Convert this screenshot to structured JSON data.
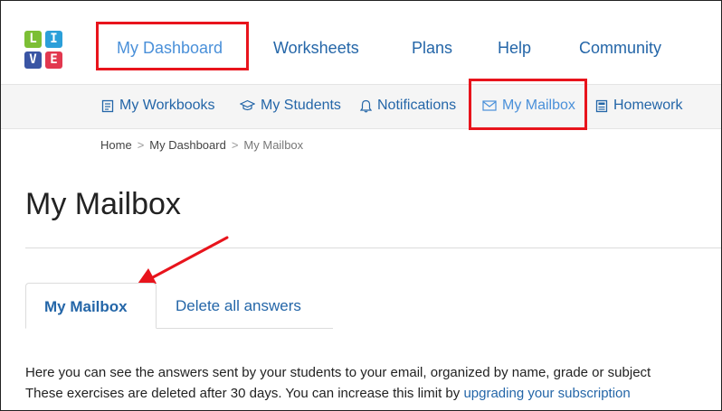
{
  "logo": {
    "letters": [
      "L",
      "I",
      "V",
      "E"
    ],
    "colors": [
      "#7cbf35",
      "#2b9fd9",
      "#3a55a4",
      "#e2384f"
    ]
  },
  "main_menu": {
    "dashboard": "My Dashboard",
    "worksheets": "Worksheets",
    "plans": "Plans",
    "help": "Help",
    "community": "Community"
  },
  "sub_menu": {
    "workbooks": {
      "label": "My Workbooks",
      "icon": "workbook-icon"
    },
    "students": {
      "label": "My Students",
      "icon": "graduation-cap-icon"
    },
    "notifications": {
      "label": "Notifications",
      "icon": "bell-icon"
    },
    "mailbox": {
      "label": "My Mailbox",
      "icon": "envelope-icon"
    },
    "homework": {
      "label": "Homework",
      "icon": "homework-icon"
    }
  },
  "breadcrumb": {
    "items": [
      "Home",
      "My Dashboard",
      "My Mailbox"
    ],
    "separator": ">"
  },
  "page": {
    "title": "My Mailbox"
  },
  "tabs": {
    "active": "My Mailbox",
    "delete_all": "Delete all answers"
  },
  "info": {
    "line1": "Here you can see the answers sent by your students to your email, organized by name, grade or subject",
    "line2_prefix": "These exercises are deleted after 30 days. You can increase this limit by ",
    "line2_link": "upgrading your subscription"
  },
  "colors": {
    "link": "#2466a8",
    "active_link": "#4a90d9",
    "annotation": "#e8141c"
  }
}
